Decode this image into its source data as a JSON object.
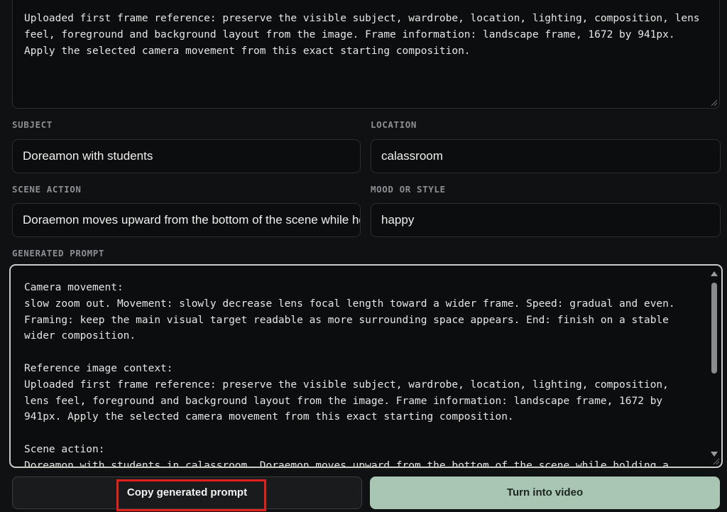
{
  "reference_text": "Uploaded first frame reference: preserve the visible subject, wardrobe, location, lighting, composition, lens feel, foreground and background layout from the image. Frame information: landscape frame, 1672 by 941px. Apply the selected camera movement from this exact starting composition.",
  "fields": {
    "subject": {
      "label": "SUBJECT",
      "value": "Doreamon with students"
    },
    "location": {
      "label": "LOCATION",
      "value": "calassroom"
    },
    "scene_action": {
      "label": "SCENE ACTION",
      "value": "Doraemon moves upward from the bottom of the scene while holding a gift"
    },
    "mood": {
      "label": "MOOD OR STYLE",
      "value": "happy"
    }
  },
  "generated": {
    "label": "GENERATED PROMPT",
    "text": "Camera movement:\nslow zoom out. Movement: slowly decrease lens focal length toward a wider frame. Speed: gradual and even. Framing: keep the main visual target readable as more surrounding space appears. End: finish on a stable wider composition.\n\nReference image context:\nUploaded first frame reference: preserve the visible subject, wardrobe, location, lighting, composition, lens feel, foreground and background layout from the image. Frame information: landscape frame, 1672 by 941px. Apply the selected camera movement from this exact starting composition.\n\nScene action:\nDoreamon with students in calassroom. Doraemon moves upward from the bottom of the scene while holding a gift"
  },
  "buttons": {
    "copy": "Copy generated prompt",
    "turn": "Turn into video"
  },
  "colors": {
    "accent": "#a9c6b2",
    "highlight": "#e3211c",
    "background": "#101112"
  }
}
